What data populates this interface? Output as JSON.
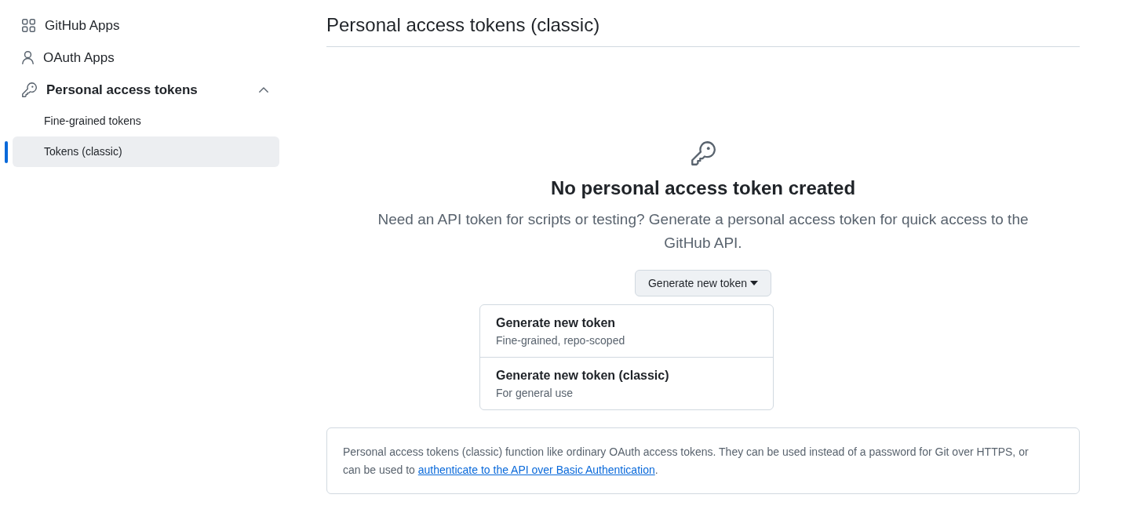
{
  "sidebar": {
    "items": [
      {
        "label": "GitHub Apps"
      },
      {
        "label": "OAuth Apps"
      },
      {
        "label": "Personal access tokens",
        "expanded": true,
        "children": [
          {
            "label": "Fine-grained tokens",
            "selected": false
          },
          {
            "label": "Tokens (classic)",
            "selected": true
          }
        ]
      }
    ]
  },
  "page": {
    "title": "Personal access tokens (classic)"
  },
  "empty_state": {
    "heading": "No personal access token created",
    "description": "Need an API token for scripts or testing? Generate a personal access token for quick access to the GitHub API.",
    "button": {
      "label": "Generate new token",
      "expanded": true,
      "menu": [
        {
          "title": "Generate new token",
          "subtitle": "Fine-grained, repo-scoped"
        },
        {
          "title": "Generate new token (classic)",
          "subtitle": "For general use"
        }
      ]
    }
  },
  "info": {
    "text": "Personal access tokens (classic) function like ordinary OAuth access tokens. They can be used instead of a password for Git over HTTPS, or can be used to ",
    "link": "authenticate to the API over Basic Authentication",
    "suffix": "."
  }
}
